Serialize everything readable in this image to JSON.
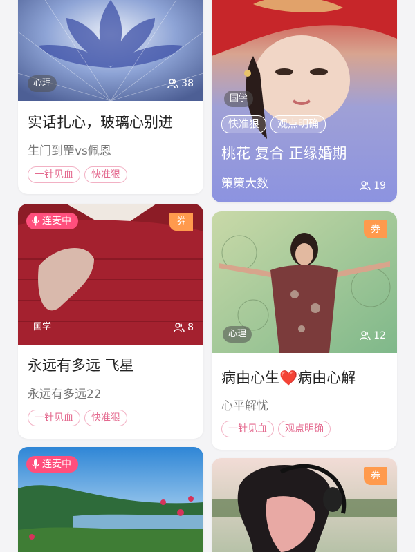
{
  "cards": [
    {
      "category": "心理",
      "count": "38",
      "title": "实话扎心，玻璃心别进",
      "subtitle": "生门到罡vs佩恩",
      "tags": [
        "一针见血",
        "快准狠"
      ]
    },
    {
      "category": "国学",
      "count": "19",
      "title": "桃花 复合 正缘婚期",
      "subtitle": "策策大数",
      "tags": [
        "快准狠",
        "观点明确"
      ]
    },
    {
      "live_label": "连麦中",
      "coupon": "券",
      "category": "国学",
      "count": "8",
      "title": "永远有多远 飞星",
      "subtitle": "永远有多远22",
      "tags": [
        "一针见血",
        "快准狠"
      ]
    },
    {
      "coupon": "券",
      "category": "心理",
      "count": "12",
      "title_a": "病由心生",
      "title_heart": "❤️",
      "title_b": "病由心解",
      "subtitle": "心平解忧",
      "tags": [
        "一针见血",
        "观点明确"
      ]
    },
    {
      "live_label": "连麦中"
    },
    {
      "coupon": "券"
    }
  ],
  "colors": {
    "pink_accent": "#ff4f7d",
    "coupon_orange": "#ff9a4d",
    "tag_border": "#f2b1c4"
  },
  "icons": [
    "people-icon",
    "mic-icon"
  ]
}
